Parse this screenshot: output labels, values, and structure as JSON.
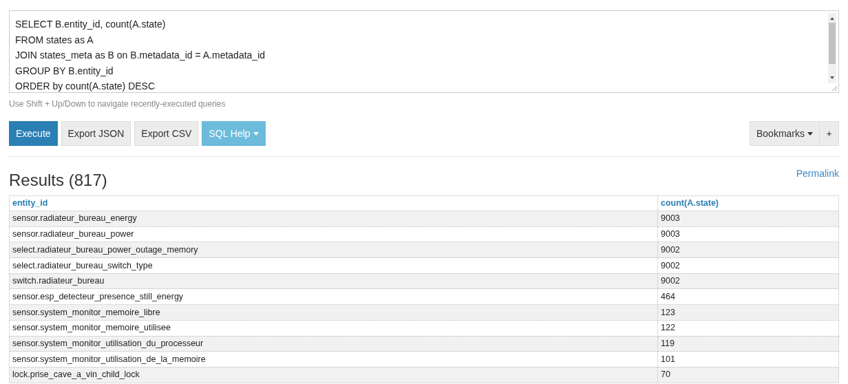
{
  "query_editor": {
    "lines": [
      "SELECT B.entity_id, count(A.state)",
      "FROM states as A",
      "JOIN states_meta as B on B.metadata_id = A.metadata_id",
      "GROUP BY B.entity_id",
      "ORDER by count(A.state) DESC"
    ]
  },
  "hint": "Use Shift + Up/Down to navigate recently-executed queries",
  "toolbar": [
    {
      "label": "Execute",
      "kind": "primary",
      "caret": false
    },
    {
      "label": "Export JSON",
      "kind": "default",
      "caret": false
    },
    {
      "label": "Export CSV",
      "kind": "default",
      "caret": false
    },
    {
      "label": "SQL Help",
      "kind": "info",
      "caret": true
    }
  ],
  "bookmarks": {
    "label": "Bookmarks",
    "add": "+"
  },
  "results": {
    "title": "Results (817)",
    "permalink": "Permalink"
  },
  "table": {
    "columns": [
      "entity_id",
      "count(A.state)"
    ],
    "rows": [
      [
        "sensor.radiateur_bureau_energy",
        "9003"
      ],
      [
        "sensor.radiateur_bureau_power",
        "9003"
      ],
      [
        "select.radiateur_bureau_power_outage_memory",
        "9002"
      ],
      [
        "select.radiateur_bureau_switch_type",
        "9002"
      ],
      [
        "switch.radiateur_bureau",
        "9002"
      ],
      [
        "sensor.esp_detecteur_presence_still_energy",
        "464"
      ],
      [
        "sensor.system_monitor_memoire_libre",
        "123"
      ],
      [
        "sensor.system_monitor_memoire_utilisee",
        "122"
      ],
      [
        "sensor.system_monitor_utilisation_du_processeur",
        "119"
      ],
      [
        "sensor.system_monitor_utilisation_de_la_memoire",
        "101"
      ],
      [
        "lock.prise_cave_a_vin_child_lock",
        "70"
      ]
    ]
  }
}
